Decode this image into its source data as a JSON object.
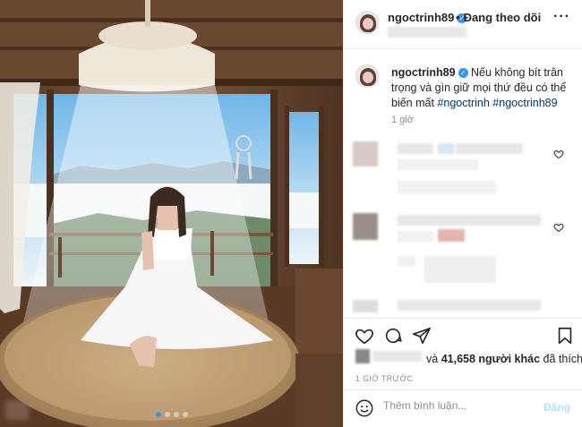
{
  "post": {
    "username": "ngoctrinh89",
    "verified_icon": "verified-badge-icon",
    "follow_separator": "•",
    "follow_label": "Đang theo dõi",
    "more_icon": "more-options-icon"
  },
  "caption": {
    "username": "ngoctrinh89",
    "text": "Nếu không bít trân trọng và gìn giữ mọi thứ đều có thể biến mất",
    "hashtags": [
      "#ngoctrinh",
      "#ngoctrinh89"
    ],
    "time": "1 giờ"
  },
  "actions": {
    "like_icon": "heart-icon",
    "comment_icon": "comment-icon",
    "share_icon": "share-icon",
    "save_icon": "bookmark-icon"
  },
  "likes": {
    "connector": "và",
    "count_text": "41,658 người khác",
    "suffix": "đã thích"
  },
  "timestamp": "1 GIỜ TRƯỚC",
  "comment_box": {
    "placeholder": "Thêm bình luận...",
    "post_label": "Đăng",
    "emoji_icon": "smiley-icon"
  },
  "colors": {
    "accent": "#3897f0",
    "hashtag": "#00376b",
    "muted": "#8e8e8e",
    "post_disabled": "#b2dffc"
  }
}
